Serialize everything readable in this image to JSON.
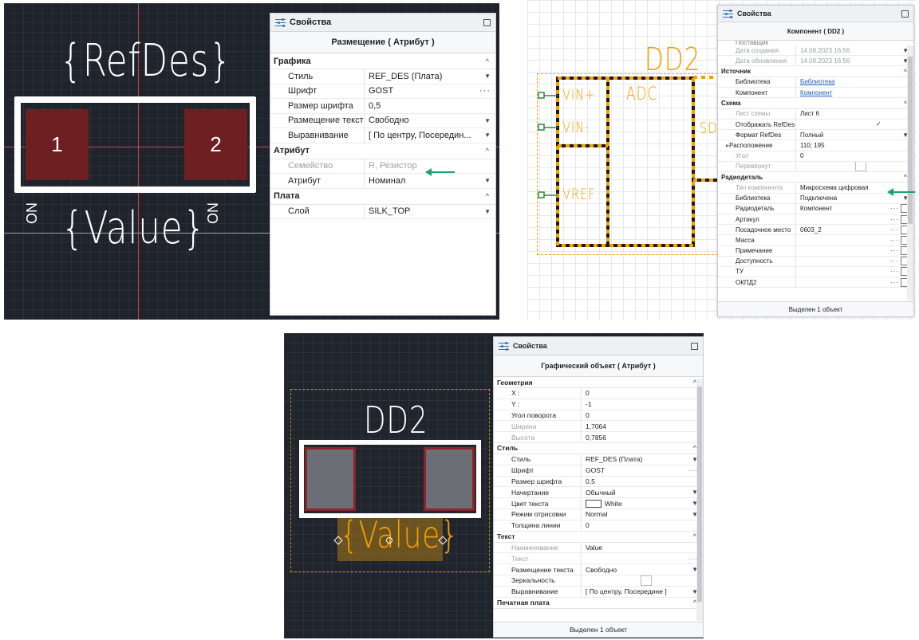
{
  "shot1": {
    "canvas": {
      "refdes": "{RefDes}",
      "value": "{Value}",
      "pad1": "1",
      "pad2": "2",
      "side_label": "NO"
    },
    "panel": {
      "title": "Свойства",
      "object": "Размещение ( Атрибут )",
      "groups": [
        {
          "name": "Графика",
          "rows": [
            {
              "k": "Стиль",
              "v": "REF_DES (Плата)",
              "ctl": "dd"
            },
            {
              "k": "Шрифт",
              "v": "GOST",
              "ctl": "el"
            },
            {
              "k": "Размер шрифта",
              "v": "0,5",
              "ctl": ""
            },
            {
              "k": "Размещение текста",
              "v": "Свободно",
              "ctl": "dd"
            },
            {
              "k": "Выравнивание",
              "v": "[ По центру, Посередин...",
              "ctl": "dd"
            }
          ]
        },
        {
          "name": "Атрибут",
          "rows": [
            {
              "k": "Семейство",
              "v": "R, Резистор",
              "ctl": "",
              "dim": true
            },
            {
              "k": "Атрибут",
              "v": "Номинал",
              "ctl": "dd"
            }
          ]
        },
        {
          "name": "Плата",
          "rows": [
            {
              "k": "Слой",
              "v": "SILK_TOP",
              "ctl": "dd"
            }
          ]
        }
      ]
    }
  },
  "shot2": {
    "canvas": {
      "refdes": "DD2",
      "block": "ADC",
      "pins": [
        "VIN+",
        "VIN-",
        "VREF"
      ],
      "cut_label": "SD"
    },
    "panel": {
      "title": "Свойства",
      "object": "Компонент ( DD2 )",
      "top_cut": "Поставщик",
      "rows_top": [
        {
          "k": "Дата создания",
          "v": "14.08.2023 16:56",
          "ctl": "dd",
          "dim": true
        },
        {
          "k": "Дата обновления",
          "v": "14.08.2023 16:56",
          "ctl": "dd",
          "dim": true
        }
      ],
      "groups": [
        {
          "name": "Источник",
          "rows": [
            {
              "k": "Библиотека",
              "v": "Библиотека",
              "ctl": "",
              "link": true
            },
            {
              "k": "Компонент",
              "v": "Компонент",
              "ctl": "",
              "link": true
            }
          ]
        },
        {
          "name": "Схема",
          "rows": [
            {
              "k": "Лист схемы",
              "v": "Лист 6",
              "ctl": "",
              "dim_k": true
            },
            {
              "k": "Отображать RefDes",
              "v": "✓",
              "ctl": "chk"
            },
            {
              "k": "Формат RefDes",
              "v": "Полный",
              "ctl": "dd"
            },
            {
              "k": "Расположение",
              "v": "110; 195",
              "ctl": "",
              "expand": true
            },
            {
              "k": "Угол",
              "v": "0",
              "ctl": "",
              "dim_k": true
            },
            {
              "k": "Перевёрнут",
              "v": "",
              "ctl": "box",
              "dim_k": true
            }
          ]
        },
        {
          "name": "Радиодеталь",
          "rows": [
            {
              "k": "Тип компонента",
              "v": "Микросхема цифровая",
              "ctl": "",
              "dim_k": true
            },
            {
              "k": "Библиотека",
              "v": "Подключена",
              "ctl": "dd"
            },
            {
              "k": "Радиодеталь",
              "v": "Компонент",
              "ctl": "elcb"
            },
            {
              "k": "Артикул",
              "v": "",
              "ctl": "elcb"
            },
            {
              "k": "Посадочное место",
              "v": "0603_2",
              "ctl": "elcb"
            },
            {
              "k": "Масса",
              "v": "",
              "ctl": "elcb"
            },
            {
              "k": "Примечание",
              "v": "",
              "ctl": "elcb"
            },
            {
              "k": "Доступность",
              "v": "",
              "ctl": "elcb"
            },
            {
              "k": "ТУ",
              "v": "",
              "ctl": "elcb"
            },
            {
              "k": "ОКПД2",
              "v": "",
              "ctl": "elcb"
            }
          ]
        }
      ],
      "status": "Выделен 1 объект"
    }
  },
  "shot3": {
    "canvas": {
      "refdes": "DD2",
      "value": "{Value}"
    },
    "panel": {
      "title": "Свойства",
      "object": "Графический объект ( Атрибут )",
      "groups": [
        {
          "name": "Геометрия",
          "rows": [
            {
              "k": "X :",
              "v": "0",
              "ctl": ""
            },
            {
              "k": "Y :",
              "v": "-1",
              "ctl": ""
            },
            {
              "k": "Угол поворота",
              "v": "0",
              "ctl": ""
            },
            {
              "k": "Ширина",
              "v": "1,7064",
              "ctl": "",
              "dim_k": true
            },
            {
              "k": "Высота",
              "v": "0,7856",
              "ctl": "",
              "dim_k": true
            }
          ]
        },
        {
          "name": "Стиль",
          "rows": [
            {
              "k": "Стиль",
              "v": "REF_DES (Плата)",
              "ctl": "dd"
            },
            {
              "k": "Шрифт",
              "v": "GOST",
              "ctl": "el"
            },
            {
              "k": "Размер шрифта",
              "v": "0,5",
              "ctl": ""
            },
            {
              "k": "Начертание",
              "v": "Обычный",
              "ctl": "dd"
            },
            {
              "k": "Цвет текста",
              "v": "White",
              "ctl": "dd",
              "swatch": true
            },
            {
              "k": "Режим отрисовки",
              "v": "Normal",
              "ctl": "dd"
            },
            {
              "k": "Толщина линии",
              "v": "0",
              "ctl": ""
            }
          ]
        },
        {
          "name": "Текст",
          "rows": [
            {
              "k": "Наименование",
              "v": "Value",
              "ctl": "",
              "dim_k": true
            },
            {
              "k": "Текст",
              "v": "",
              "ctl": "el",
              "dim_k": true
            },
            {
              "k": "Размещение текста",
              "v": "Свободно",
              "ctl": "dd"
            },
            {
              "k": "Зеркальность",
              "v": "",
              "ctl": "box"
            },
            {
              "k": "Выравнивание",
              "v": "[ По центру, Посередине ]",
              "ctl": "dd"
            }
          ]
        },
        {
          "name": "Печатная плата",
          "rows": []
        }
      ],
      "status": "Выделен 1 объект"
    }
  },
  "colors": {
    "pad": "#6e1f22",
    "silk": "#ffffff",
    "accent_orange": "#f5a000",
    "arrow": "#1aa36e"
  }
}
